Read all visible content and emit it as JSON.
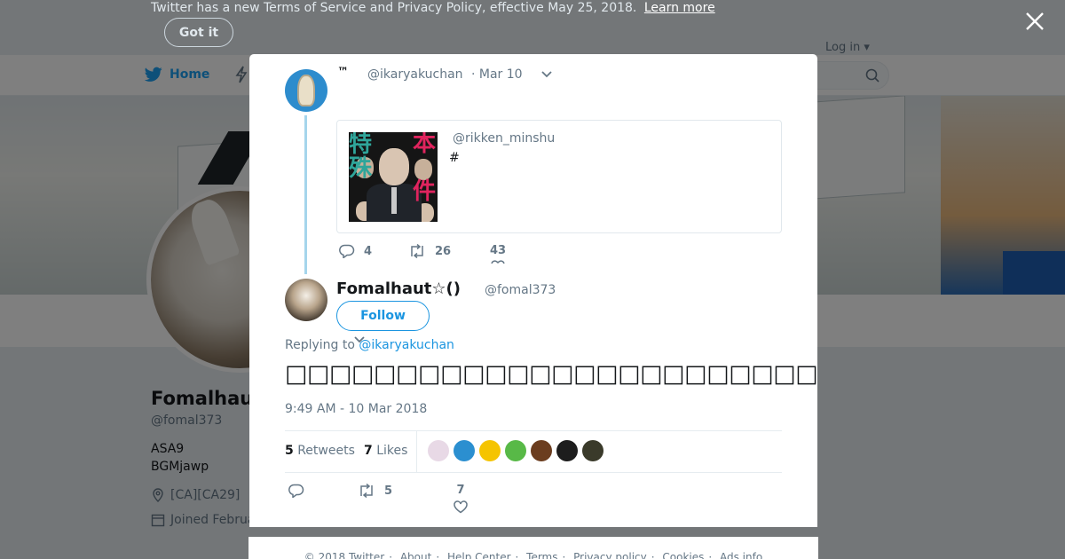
{
  "terms_banner": {
    "text": "Twitter has a new Terms of Service and Privacy Policy, effective May 25, 2018.",
    "link_label": "Learn more",
    "button_label": "Got it"
  },
  "nav": {
    "home_label": "Home",
    "login_label": "Log in ▾"
  },
  "profile": {
    "name": "Fomalhaut☆()",
    "name_visible": "Fomalhau",
    "handle": "@fomal373",
    "bio_line1": "ASA9",
    "bio_line2": "BGMjawp",
    "location": "[CA][CA29]",
    "joined": "Joined Februa"
  },
  "parent_tweet": {
    "name": "™",
    "handle": "@ikaryakuchan",
    "date": "· Mar 10",
    "quote": {
      "handle": "@rikken_minshu",
      "text": "#",
      "image_kanji": [
        "特",
        "殊",
        "本",
        "件"
      ]
    },
    "reply_count": "4",
    "retweet_count": "26",
    "like_count": "43"
  },
  "main_tweet": {
    "name": "Fomalhaut☆()",
    "handle": "@fomal373",
    "follow_label": "Follow",
    "replying_prefix": "Replying to",
    "replying_handle": "@ikaryakuchan",
    "text": "□□□□□□□□□□□□□□□□□□□□□□□□□□□□□□□□□□□□□□□□□□",
    "timestamp": "9:49 AM - 10 Mar 2018",
    "retweets_count": "5",
    "retweets_label": "Retweets",
    "likes_count": "7",
    "likes_label": "Likes",
    "reply_count": "",
    "retweet_count": "5",
    "like_count": "7"
  },
  "likers": [
    "#e8d9e6",
    "#2b8fd0",
    "#f5c400",
    "#58b947",
    "#6b3d1f",
    "#1d1d1d",
    "#3a3a2a"
  ],
  "footer": {
    "copyright": "© 2018 Twitter",
    "about": "About",
    "help": "Help Center",
    "terms": "Terms",
    "privacy": "Privacy policy",
    "cookies": "Cookies",
    "ads": "Ads info"
  },
  "colors": {
    "accent": "#1da1f2",
    "link": "#1b95e0",
    "muted": "#657786",
    "thread_line": "#a5d5ec"
  }
}
